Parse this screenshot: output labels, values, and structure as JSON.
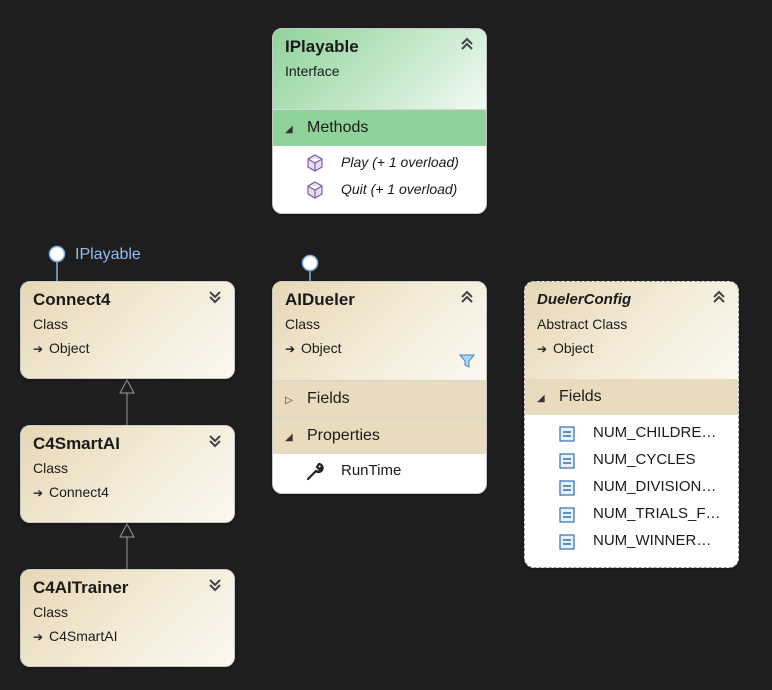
{
  "diagram": {
    "interface": {
      "name": "IPlayable",
      "kind": "Interface",
      "compartment": "Methods",
      "methods": [
        "Play (+ 1 overload)",
        "Quit (+ 1 overload)"
      ]
    },
    "classes": {
      "connect4": {
        "name": "Connect4",
        "kind": "Class",
        "base": "Object",
        "implements_label": "IPlayable"
      },
      "c4smartai": {
        "name": "C4SmartAI",
        "kind": "Class",
        "base": "Connect4"
      },
      "c4aitrainer": {
        "name": "C4AITrainer",
        "kind": "Class",
        "base": "C4SmartAI"
      },
      "aidueler": {
        "name": "AIDueler",
        "kind": "Class",
        "base": "Object",
        "fields_label": "Fields",
        "properties_label": "Properties",
        "properties": [
          "RunTime"
        ]
      },
      "duelerconfig": {
        "name": "DuelerConfig",
        "kind": "Abstract Class",
        "base": "Object",
        "fields_label": "Fields",
        "fields": [
          "NUM_CHILDRE…",
          "NUM_CYCLES",
          "NUM_DIVISION…",
          "NUM_TRIALS_F…",
          "NUM_WINNER…"
        ]
      }
    }
  },
  "colors": {
    "background": "#1e1e1e",
    "class_header": "#e9dcbe",
    "interface_header": "#8fd39a",
    "lollipop_label": "#8fbff0"
  },
  "icons": {
    "method": "cube-icon",
    "property": "wrench-icon",
    "field": "field-icon",
    "collapse": "double-chevron-up-icon",
    "expand": "double-chevron-down-icon",
    "filter": "filter-icon",
    "inherits": "arrow-right-icon"
  }
}
